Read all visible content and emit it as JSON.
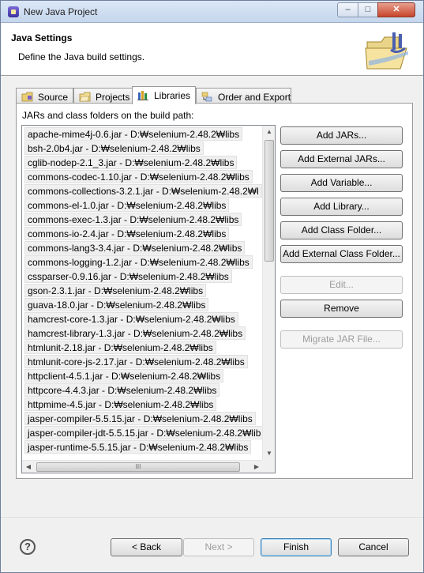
{
  "window": {
    "title": "New Java Project",
    "controls": {
      "minimize": "–",
      "maximize": "□",
      "close": "✕"
    }
  },
  "banner": {
    "title": "Java Settings",
    "description": "Define the Java build settings.",
    "image_icon": "java-folder-wizard-icon"
  },
  "tabs": [
    {
      "label": "Source",
      "icon": "source-folder-icon",
      "active": false
    },
    {
      "label": "Projects",
      "icon": "projects-icon",
      "active": false
    },
    {
      "label": "Libraries",
      "icon": "libraries-icon",
      "active": true
    },
    {
      "label": "Order and Export",
      "icon": "order-export-icon",
      "active": false
    }
  ],
  "libraries": {
    "label": "JARs and class folders on the build path:",
    "items": [
      "apache-mime4j-0.6.jar - D:₩selenium-2.48.2₩libs",
      "bsh-2.0b4.jar - D:₩selenium-2.48.2₩libs",
      "cglib-nodep-2.1_3.jar - D:₩selenium-2.48.2₩libs",
      "commons-codec-1.10.jar - D:₩selenium-2.48.2₩libs",
      "commons-collections-3.2.1.jar - D:₩selenium-2.48.2₩l",
      "commons-el-1.0.jar - D:₩selenium-2.48.2₩libs",
      "commons-exec-1.3.jar - D:₩selenium-2.48.2₩libs",
      "commons-io-2.4.jar - D:₩selenium-2.48.2₩libs",
      "commons-lang3-3.4.jar - D:₩selenium-2.48.2₩libs",
      "commons-logging-1.2.jar - D:₩selenium-2.48.2₩libs",
      "cssparser-0.9.16.jar - D:₩selenium-2.48.2₩libs",
      "gson-2.3.1.jar - D:₩selenium-2.48.2₩libs",
      "guava-18.0.jar - D:₩selenium-2.48.2₩libs",
      "hamcrest-core-1.3.jar - D:₩selenium-2.48.2₩libs",
      "hamcrest-library-1.3.jar - D:₩selenium-2.48.2₩libs",
      "htmlunit-2.18.jar - D:₩selenium-2.48.2₩libs",
      "htmlunit-core-js-2.17.jar - D:₩selenium-2.48.2₩libs",
      "httpclient-4.5.1.jar - D:₩selenium-2.48.2₩libs",
      "httpcore-4.4.3.jar - D:₩selenium-2.48.2₩libs",
      "httpmime-4.5.jar - D:₩selenium-2.48.2₩libs",
      "jasper-compiler-5.5.15.jar - D:₩selenium-2.48.2₩libs",
      "jasper-compiler-jdt-5.5.15.jar - D:₩selenium-2.48.2₩lib",
      "jasper-runtime-5.5.15.jar - D:₩selenium-2.48.2₩libs"
    ],
    "hscroll_thumb": "III"
  },
  "side_buttons": [
    {
      "label": "Add JARs...",
      "enabled": true
    },
    {
      "label": "Add External JARs...",
      "enabled": true
    },
    {
      "label": "Add Variable...",
      "enabled": true
    },
    {
      "label": "Add Library...",
      "enabled": true
    },
    {
      "label": "Add Class Folder...",
      "enabled": true
    },
    {
      "label": "Add External Class Folder...",
      "enabled": true
    },
    {
      "label": "Edit...",
      "enabled": false
    },
    {
      "label": "Remove",
      "enabled": true
    },
    {
      "label": "Migrate JAR File...",
      "enabled": false
    }
  ],
  "footer": {
    "help": "?",
    "back": "< Back",
    "next": "Next >",
    "finish": "Finish",
    "cancel": "Cancel"
  }
}
